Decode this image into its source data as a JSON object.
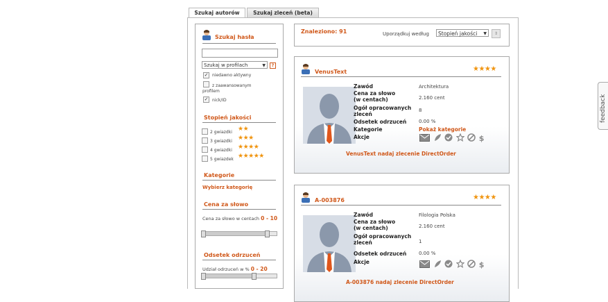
{
  "tabs": [
    {
      "label": "Szukaj autorów",
      "active": true
    },
    {
      "label": "Szukaj zleceń (beta)",
      "active": false
    }
  ],
  "sidebar": {
    "search_title": "Szukaj hasła",
    "search_value": "",
    "select_value": "Szukaj w profilach",
    "help_label": "?",
    "checkboxes": [
      {
        "label": "niedawno aktywny",
        "checked": true
      },
      {
        "label": "z zaawansowanym profilem",
        "checked": false
      },
      {
        "label": "nick/ID",
        "checked": true
      }
    ],
    "quality_title": "Stopień jakości",
    "quality_options": [
      {
        "label": "2 gwiazdki",
        "stars": "★★"
      },
      {
        "label": "3 gwiazdki",
        "stars": "★★★"
      },
      {
        "label": "4 gwiazdki",
        "stars": "★★★★"
      },
      {
        "label": "5 gwiazdek",
        "stars": "★★★★★"
      }
    ],
    "category_title": "Kategorie",
    "category_link": "Wybierz kategorię",
    "price_title": "Cena za słowo",
    "price_label": "Cena za słowo w centach",
    "price_range": "0 - 10",
    "rejection_title": "Odsetek odrzuceń",
    "rejection_label": "Udział odrzuceń w %",
    "rejection_range": "0 - 20"
  },
  "results": {
    "found": "Znaleziono: 91",
    "sort_label": "Uporządkuj według",
    "sort_value": "Stopień jakości"
  },
  "field_labels": {
    "occupation": "Zawód",
    "price": "Cena za słowo\n(w centach)",
    "orders": "Ogół opracowanych\nzleceń",
    "rejections": "Odsetek odrzuceń",
    "category": "Kategorie",
    "actions": "Akcje"
  },
  "cards": [
    {
      "name": "VenusText",
      "stars": "★★★★",
      "occupation": "Architektura",
      "price": "2.160 cent",
      "orders": "8",
      "rejections": "0.00 %",
      "category_link": "Pokaż kategorie",
      "order_link": "VenusText nadaj zlecenie DirectOrder"
    },
    {
      "name": "A-003876",
      "stars": "★★★★",
      "occupation": "Filologia Polska",
      "price": "2.160 cent",
      "orders": "1",
      "rejections": "0.00 %",
      "category_link": "",
      "order_link": "A-003876 nadaj zlecenie DirectOrder"
    }
  ],
  "feedback_label": "feedback",
  "colors": {
    "accent": "#d0581a",
    "star": "#f0940f",
    "border": "#a9a9a9"
  }
}
